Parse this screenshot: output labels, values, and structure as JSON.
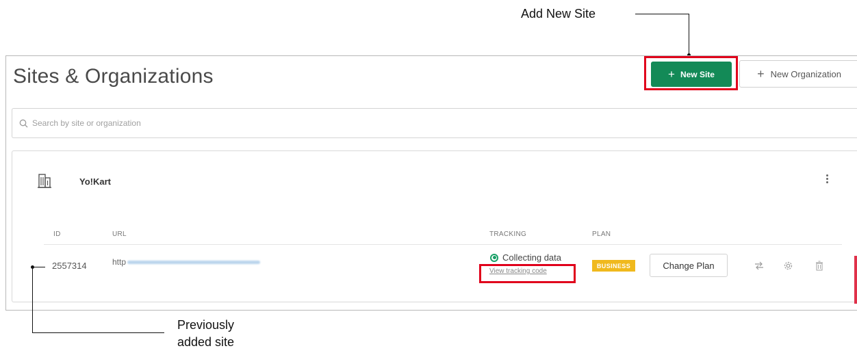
{
  "callouts": {
    "add_new_site": "Add New Site",
    "previously_line1": "Previously",
    "previously_line2": "added site"
  },
  "page": {
    "title": "Sites & Organizations"
  },
  "toolbar": {
    "new_site_label": "New Site",
    "new_org_label": "New Organization"
  },
  "search": {
    "placeholder": "Search by site or organization"
  },
  "organization": {
    "name": "Yo!Kart",
    "columns": {
      "id": "ID",
      "url": "URL",
      "tracking": "TRACKING",
      "plan": "PLAN"
    },
    "sites": [
      {
        "id": "2557314",
        "url_prefix": "http",
        "tracking_status": "Collecting data",
        "tracking_link": "View tracking code",
        "plan": "BUSINESS",
        "change_plan_label": "Change Plan"
      }
    ]
  },
  "colors": {
    "primary": "#138a57",
    "highlight": "#e0001b",
    "badge": "#f0b91d"
  },
  "icons": [
    "search-icon",
    "building-icon",
    "kebab-menu-icon",
    "status-ok-icon",
    "transfer-icon",
    "gear-icon",
    "trash-icon",
    "plus-icon"
  ]
}
